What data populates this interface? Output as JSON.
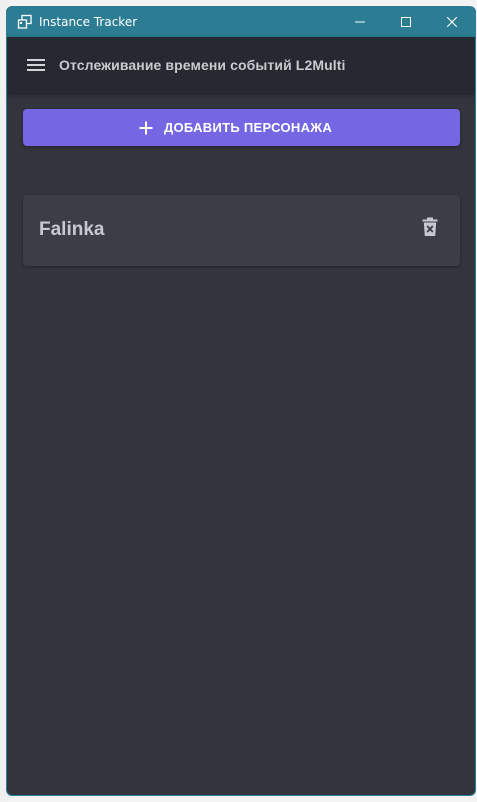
{
  "window": {
    "title": "Instance Tracker",
    "icon": "app-window-icon",
    "controls": [
      "minimize-icon",
      "maximize-icon",
      "close-icon"
    ]
  },
  "appbar": {
    "menu_icon": "hamburger-menu-icon",
    "title": "Отслеживание времени событий L2Multi"
  },
  "actions": {
    "add_character_label": "ДОБАВИТЬ ПЕРСОНАЖА",
    "add_icon": "plus-icon"
  },
  "characters": [
    {
      "name": "Falinka",
      "delete_icon": "trash-delete-icon"
    }
  ],
  "colors": {
    "titlebar": "#2c7d93",
    "appbar": "#272931",
    "background": "#33353e",
    "card": "#3b3d47",
    "accent": "#7567e4"
  }
}
